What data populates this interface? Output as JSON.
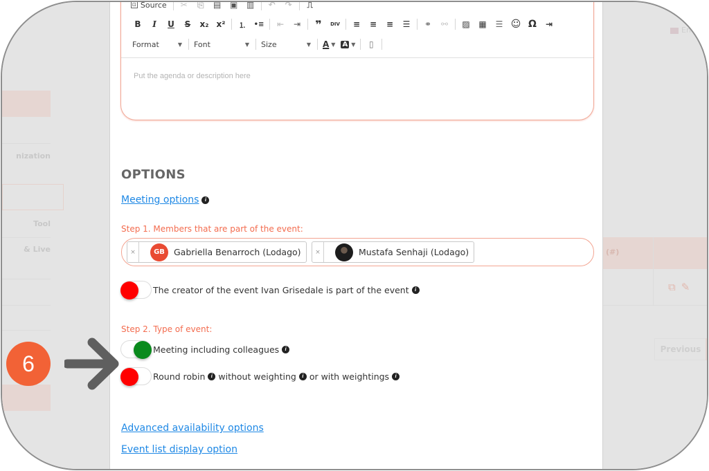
{
  "background": {
    "left_menu": [
      {
        "label": "",
        "highlighted": true
      },
      {
        "label": ""
      },
      {
        "label": "nization"
      },
      {
        "label": ""
      },
      {
        "label": "Tool"
      },
      {
        "label": "& Live"
      },
      {
        "label": ""
      },
      {
        "label": ""
      },
      {
        "label": "",
        "highlighted": true
      }
    ],
    "language": "En",
    "table_header": "(#)",
    "pagination_previous": "Previous"
  },
  "editor": {
    "toolbar": {
      "row0": {
        "source_label": "Source"
      },
      "row1": [
        {
          "icon": "bold-icon",
          "glyph": "B"
        },
        {
          "icon": "italic-icon",
          "glyph": "I"
        },
        {
          "icon": "underline-icon",
          "glyph": "U"
        },
        {
          "icon": "strikethrough-icon",
          "glyph": "S"
        },
        {
          "icon": "subscript-icon",
          "glyph": "x₂"
        },
        {
          "icon": "superscript-icon",
          "glyph": "x²"
        },
        {
          "icon": "numbered-list-icon",
          "glyph": "⒈"
        },
        {
          "icon": "bulleted-list-icon",
          "glyph": "•≡"
        },
        {
          "icon": "outdent-icon",
          "glyph": "⇤"
        },
        {
          "icon": "indent-icon",
          "glyph": "⇥"
        },
        {
          "icon": "blockquote-icon",
          "glyph": "❞"
        },
        {
          "icon": "div-container-icon",
          "glyph": "DIV"
        },
        {
          "icon": "align-left-icon",
          "glyph": "≡"
        },
        {
          "icon": "align-center-icon",
          "glyph": "≡"
        },
        {
          "icon": "align-right-icon",
          "glyph": "≡"
        },
        {
          "icon": "justify-icon",
          "glyph": "☰"
        },
        {
          "icon": "link-icon",
          "glyph": "⚭"
        },
        {
          "icon": "unlink-icon",
          "glyph": "⚯"
        },
        {
          "icon": "image-icon",
          "glyph": "▨"
        },
        {
          "icon": "table-icon",
          "glyph": "▦"
        },
        {
          "icon": "horizontal-rule-icon",
          "glyph": "☰"
        },
        {
          "icon": "smiley-icon",
          "glyph": "☺"
        },
        {
          "icon": "special-char-icon",
          "glyph": "Ω"
        },
        {
          "icon": "page-break-icon",
          "glyph": "⇥"
        }
      ],
      "format_label": "Format",
      "font_label": "Font",
      "size_label": "Size",
      "text_color_glyph": "A",
      "bg_color_glyph": "A"
    },
    "placeholder": "Put the agenda or description here"
  },
  "options": {
    "title": "OPTIONS",
    "meeting_options_link": "Meeting options",
    "step1_label": "Step 1. Members that are part of the event:",
    "members": [
      {
        "initials": "GB",
        "name": "Gabriella Benarroch (Lodago)",
        "remove": "×"
      },
      {
        "initials": "",
        "name": "Mustafa Senhaji (Lodago)",
        "remove": "×"
      }
    ],
    "creator_toggle": {
      "label": "The creator of the event Ivan Grisedale is part of the event",
      "on": false
    },
    "step2_label": "Step 2. Type of event:",
    "meeting_toggle": {
      "label": "Meeting including colleagues",
      "on": true
    },
    "round_robin_toggle": {
      "label_part1": "Round robin",
      "label_part2": "without weighting",
      "label_part3": "or with weightings",
      "on": false
    },
    "advanced_link": "Advanced availability options",
    "event_list_link": "Event list display option"
  },
  "annotation": {
    "step_number": "6"
  },
  "colors": {
    "accent_orange": "#f36c4f",
    "link_blue": "#1e88e5",
    "toggle_on": "#0a8a1d",
    "toggle_off": "#ff0000",
    "badge": "#f26236"
  }
}
